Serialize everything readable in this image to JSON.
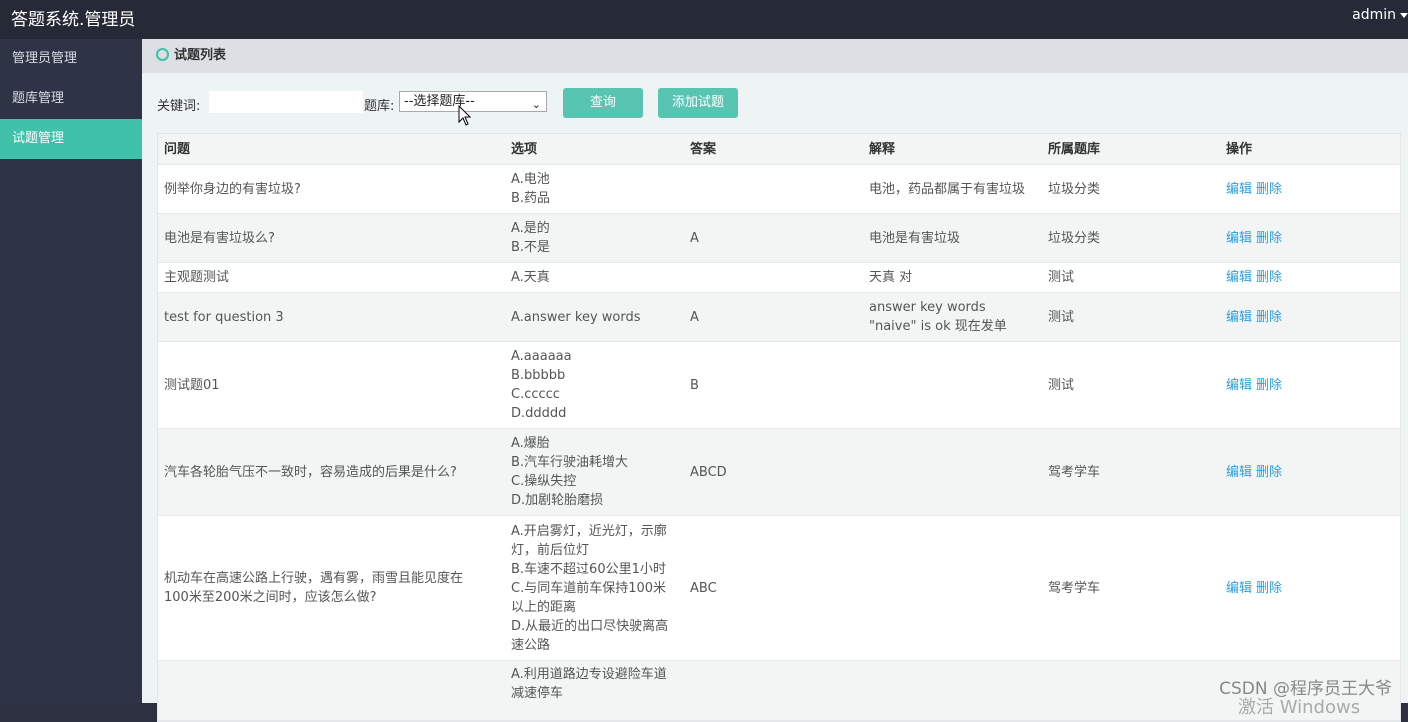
{
  "app": {
    "title": "答题系统.管理员",
    "user": "admin"
  },
  "sidebar": {
    "items": [
      {
        "label": "管理员管理",
        "active": false
      },
      {
        "label": "题库管理",
        "active": false
      },
      {
        "label": "试题管理",
        "active": true
      }
    ]
  },
  "panel": {
    "title": "试题列表"
  },
  "filter": {
    "keyword_label": "关键词:",
    "keyword_value": "",
    "bank_label": "题库:",
    "bank_selected": "--选择题库--",
    "query_button": "查询",
    "add_button": "添加试题"
  },
  "table": {
    "headers": [
      "问题",
      "选项",
      "答案",
      "解释",
      "所属题库",
      "操作"
    ],
    "edit_label": "编辑",
    "delete_label": "删除",
    "rows": [
      {
        "question": [
          "例举你身边的有害垃圾?"
        ],
        "options": [
          "A.电池",
          "B.药品"
        ],
        "answer": "",
        "explanation": [
          "电池，药品都属于有害垃圾"
        ],
        "bank": "垃圾分类"
      },
      {
        "question": [
          "电池是有害垃圾么?"
        ],
        "options": [
          "A.是的",
          "B.不是"
        ],
        "answer": "A",
        "explanation": [
          "电池是有害垃圾"
        ],
        "bank": "垃圾分类"
      },
      {
        "question": [
          "主观题测试"
        ],
        "options": [
          "A.天真"
        ],
        "answer": "",
        "explanation": [
          "天真 对"
        ],
        "bank": "测试"
      },
      {
        "question": [
          "test for question 3"
        ],
        "options": [
          "A.answer key words"
        ],
        "answer": "A",
        "explanation": [
          "answer key words",
          "\"naive\" is ok 现在发单"
        ],
        "bank": "测试"
      },
      {
        "question": [
          "测试题01"
        ],
        "options": [
          "A.aaaaaa",
          "B.bbbbb",
          "C.ccccc",
          "D.ddddd"
        ],
        "answer": "B",
        "explanation": [],
        "bank": "测试"
      },
      {
        "question": [
          "汽车各轮胎气压不一致时，容易造成的后果是什么?"
        ],
        "options": [
          "A.爆胎",
          "B.汽车行驶油耗增大",
          "C.操纵失控",
          "D.加剧轮胎磨损"
        ],
        "answer": "ABCD",
        "explanation": [],
        "bank": "驾考学车"
      },
      {
        "question": [
          "机动车在高速公路上行驶，遇有雾，雨雪且能见度在",
          "100米至200米之间时，应该怎么做?"
        ],
        "options": [
          "A.开启雾灯，近光灯，示廓",
          "灯，前后位灯",
          "B.车速不超过60公里1小时",
          "C.与同车道前车保持100米",
          "以上的距离",
          "D.从最近的出口尽快驶离高",
          "速公路"
        ],
        "answer": "ABC",
        "explanation": [],
        "bank": "驾考学车"
      },
      {
        "question": [],
        "options": [
          "A.利用道路边专设避险车道",
          "减速停车"
        ],
        "answer": "",
        "explanation": [],
        "bank": ""
      }
    ]
  },
  "watermark": {
    "text": "CSDN @程序员王大爷",
    "text2": "激活 Windows"
  }
}
